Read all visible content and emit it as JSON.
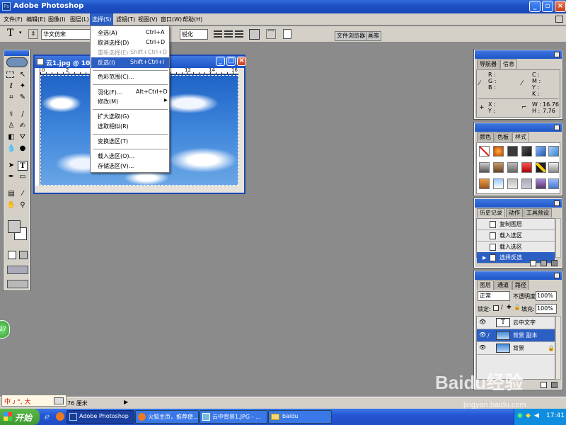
{
  "window": {
    "title": "Adobe Photoshop"
  },
  "menubar": [
    "文件(F)",
    "编辑(E)",
    "图像(I)",
    "图层(L)",
    "选择(S)",
    "滤镜(T)",
    "视图(V)",
    "窗口(W)",
    "帮助(H)"
  ],
  "options": {
    "font": "华文仿宋",
    "antialias": "锐化",
    "tabs": [
      "文件浏览器",
      "画笔"
    ]
  },
  "select_menu": {
    "items": [
      {
        "label": "全选(A)",
        "shortcut": "Ctrl+A"
      },
      {
        "label": "取消选择(D)",
        "shortcut": "Ctrl+D"
      },
      {
        "label": "重新选择(E)",
        "shortcut": "Shift+Ctrl+D"
      },
      {
        "label": "反选(I)",
        "shortcut": "Shift+Ctrl+I"
      },
      {
        "label": "色彩范围(C)...",
        "shortcut": ""
      },
      {
        "label": "羽化(F)...",
        "shortcut": "Alt+Ctrl+D"
      },
      {
        "label": "修改(M)",
        "shortcut": "▶"
      },
      {
        "label": "扩大选取(G)",
        "shortcut": ""
      },
      {
        "label": "选取相似(R)",
        "shortcut": ""
      },
      {
        "label": "变换选区(T)",
        "shortcut": ""
      },
      {
        "label": "载入选区(O)...",
        "shortcut": ""
      },
      {
        "label": "存储选区(V)...",
        "shortcut": ""
      }
    ]
  },
  "document": {
    "title": "云1.jpg @ 100%",
    "ruler": [
      "0",
      "2",
      "4",
      "6",
      "8",
      "10",
      "12",
      "14",
      "16"
    ]
  },
  "navigator": {
    "tabs": [
      "导航器",
      "信息"
    ],
    "rgb": [
      "R :",
      "G :",
      "B :"
    ],
    "cmyk": [
      "C :",
      "M :",
      "Y :",
      "K :"
    ],
    "xy": [
      "X :",
      "Y :"
    ],
    "w_label": "W :",
    "w_value": "16.76",
    "h_label": "H :",
    "h_value": "7.76"
  },
  "color_panel": {
    "tabs": [
      "颜色",
      "色板",
      "样式"
    ]
  },
  "history": {
    "tabs": [
      "历史记录",
      "动作",
      "工具预设"
    ],
    "items": [
      "复制图层",
      "载入选区",
      "载入选区",
      "选择反选"
    ]
  },
  "layers": {
    "tabs": [
      "图层",
      "通道",
      "路径"
    ],
    "blend": "正常",
    "opacity_label": "不透明度:",
    "opacity": "100%",
    "lock_label": "锁定:",
    "fill_label": "填充:",
    "fill": "100%",
    "items": [
      "云中文字",
      "背景 副本",
      "背景"
    ]
  },
  "status": {
    "zoom": "76 厘米"
  },
  "ime": {
    "text": "中 ᴊ °, 大"
  },
  "taskbar": {
    "start": "开始",
    "tasks": [
      "Adobe Photoshop",
      "火狐主页，推荐使...",
      "云中背景1.JPG - ...",
      "baidu"
    ],
    "clock": "17:41"
  },
  "watermark": {
    "logo": "Baidu经验",
    "url": "jingyan.baidu.com"
  },
  "badge": "27",
  "colors": {
    "selection": "#2c5fc4",
    "titlebar": "#1c4fc4",
    "taskbar": "#2455d3",
    "start": "#3c9a30"
  }
}
